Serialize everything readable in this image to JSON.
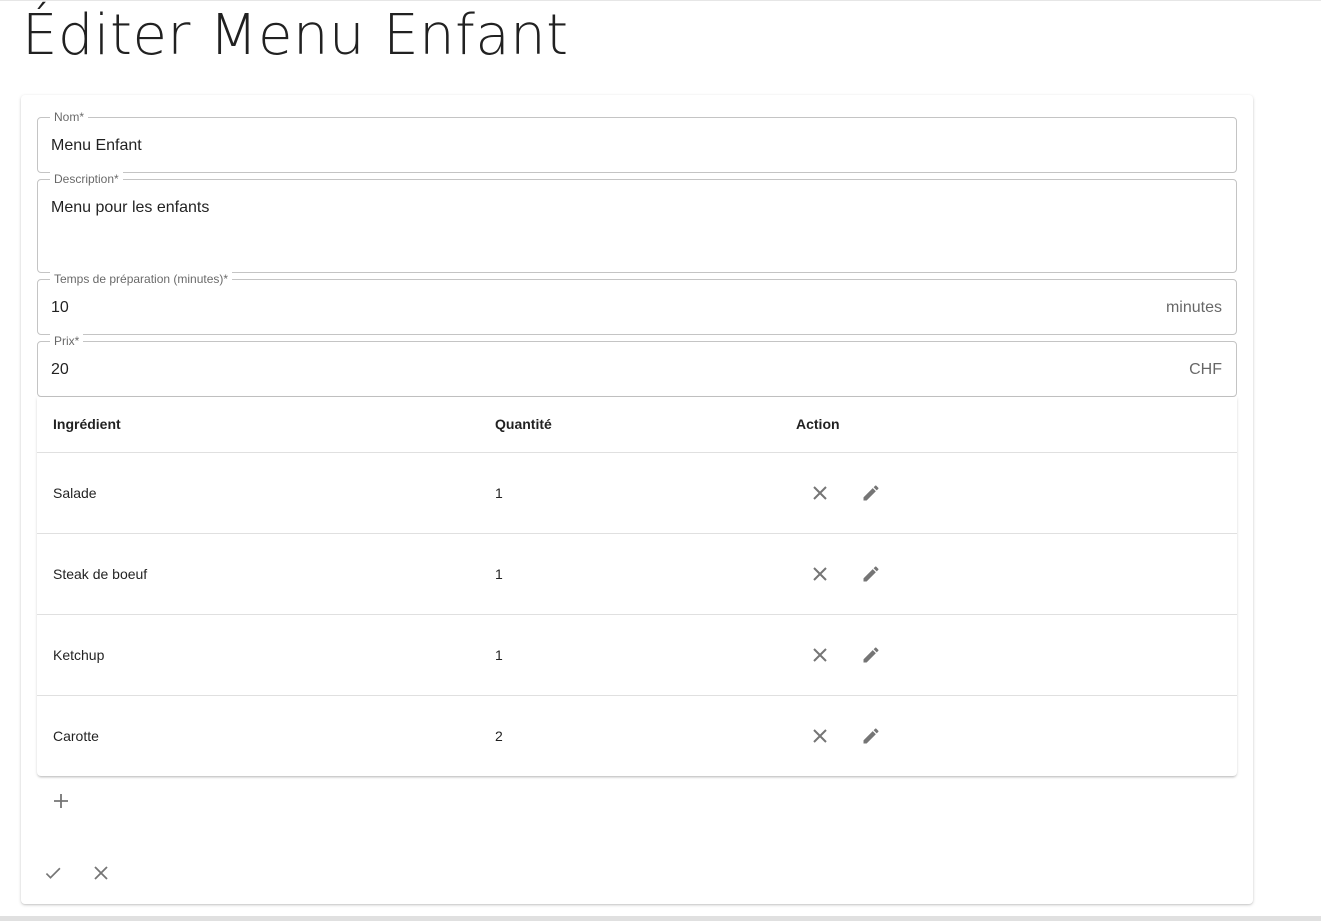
{
  "page": {
    "title": "Éditer Menu Enfant"
  },
  "form": {
    "name": {
      "label": "Nom*",
      "value": "Menu Enfant"
    },
    "description": {
      "label": "Description*",
      "value": "Menu pour les enfants"
    },
    "prep_time": {
      "label": "Temps de préparation (minutes)*",
      "value": "10",
      "suffix": "minutes"
    },
    "price": {
      "label": "Prix*",
      "value": "20",
      "suffix": "CHF"
    }
  },
  "ingredients_table": {
    "columns": [
      "Ingrédient",
      "Quantité",
      "Action"
    ],
    "rows": [
      {
        "ingredient": "Salade",
        "quantity": "1"
      },
      {
        "ingredient": "Steak de boeuf",
        "quantity": "1"
      },
      {
        "ingredient": "Ketchup",
        "quantity": "1"
      },
      {
        "ingredient": "Carotte",
        "quantity": "2"
      }
    ],
    "row_actions": [
      "close-icon",
      "pencil-icon"
    ]
  },
  "actions": {
    "add_icon": "plus-icon",
    "confirm_icon": "check-icon",
    "cancel_icon": "close-icon"
  },
  "colors": {
    "border": "#c4c4c4",
    "icon": "#757575",
    "divider": "#e0e0e0"
  }
}
